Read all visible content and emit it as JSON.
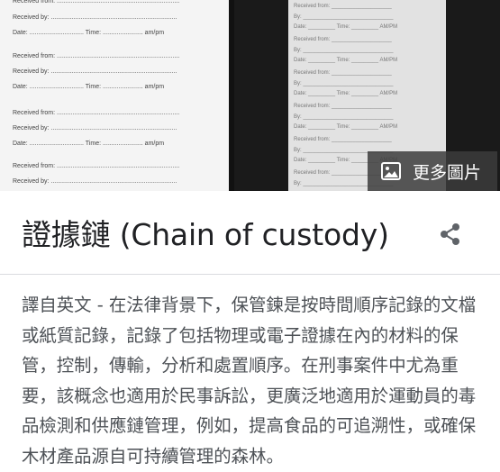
{
  "images": {
    "left_form": {
      "received_from_label": "Received from:",
      "received_by_label": "Received by:",
      "date_label": "Date:",
      "time_label": "Time:",
      "ampm_label": "am/pm"
    },
    "right_tag": {
      "received_from_label": "Received from:",
      "by_label": "By:",
      "date_label": "Date:",
      "time_label": "Time:",
      "ampm_label": "AM/PM"
    }
  },
  "more_images": {
    "label": "更多圖片",
    "icon": "image-icon"
  },
  "entity": {
    "title": "證據鏈 (Chain of custody)",
    "share_icon": "share-icon",
    "description": "譯自英文 - 在法律背景下，保管鍊是按時間順序記錄的文檔或紙質記錄，記錄了包括物理或電子證據在內的材料的保管，控制，傳輸，分析和處置順序。在刑事案件中尤為重要，該概念也適用於民事訴訟，更廣泛地適用於運動員的毒品檢測和供應鏈管理，例如，提高食品的可追溯性，或確保木材產品源自可持續管理的森林。"
  }
}
